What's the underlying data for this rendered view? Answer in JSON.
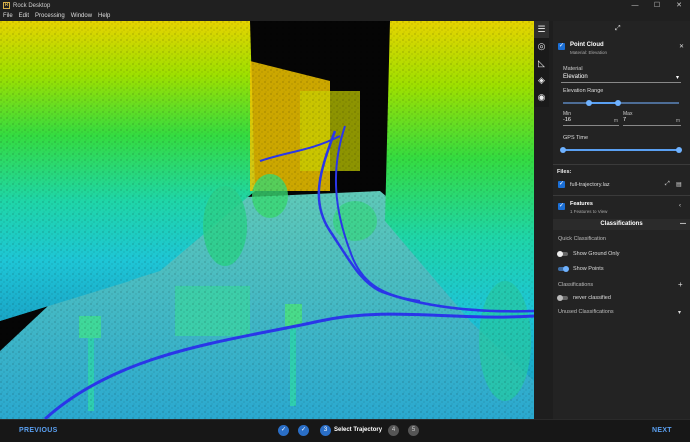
{
  "window": {
    "title": "Rock Desktop",
    "controls": [
      "—",
      "☐",
      "✕"
    ]
  },
  "menu": [
    "File",
    "Edit",
    "Processing",
    "Window",
    "Help"
  ],
  "toolstrip": {
    "icons": [
      "sliders-icon",
      "target-icon",
      "ruler-icon",
      "layers-icon",
      "eye-icon"
    ]
  },
  "panel": {
    "top_icon": "⤢",
    "point_cloud": {
      "title": "Point Cloud",
      "subtitle": "Material: Elevation",
      "material_label": "Material",
      "material_value": "Elevation",
      "elevation_label": "Elevation Range",
      "elevation_low": 0.22,
      "elevation_high": 0.47,
      "min_label": "Min",
      "max_label": "Max",
      "min_value": "-16",
      "max_value": "7",
      "unit": "m",
      "gps_label": "GPS Time",
      "gps_low": 0.0,
      "gps_high": 1.0
    },
    "files": {
      "label": "Files:",
      "items": [
        {
          "name": "full-trajectory.laz"
        }
      ]
    },
    "features": {
      "title": "Features",
      "subtitle": "1 Features to View"
    },
    "classifications_header": "Classifications",
    "quick_label": "Quick Classification",
    "show_ground": "Show Ground Only",
    "show_points": "Show Points",
    "classifications_label": "Classifications",
    "add_symbol": "+",
    "never_classified": "never classified",
    "unused_label": "Unused Classifications"
  },
  "footer": {
    "previous": "PREVIOUS",
    "next": "NEXT",
    "steps": [
      {
        "label": "✓",
        "state": "done"
      },
      {
        "label": "✓",
        "state": "done"
      },
      {
        "label": "3",
        "state": "current",
        "title": "Select Trajectory"
      },
      {
        "label": "4",
        "state": "todo"
      },
      {
        "label": "5",
        "state": "todo"
      }
    ],
    "current_label": "Select Trajectory"
  },
  "colors": {
    "accent": "#2a6ec6",
    "trajectory": "#2a36e8",
    "panel_bg": "#232323"
  }
}
